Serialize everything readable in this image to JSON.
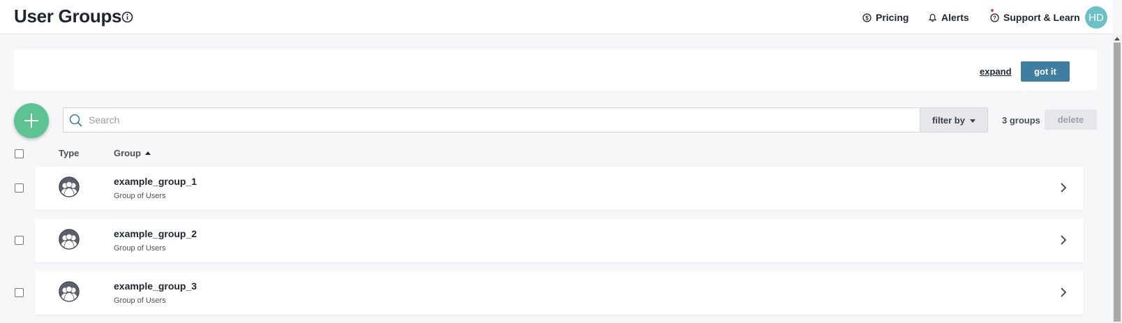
{
  "header": {
    "title": "User Groups",
    "nav": {
      "pricing": "Pricing",
      "alerts": "Alerts",
      "support": "Support & Learn"
    },
    "avatar_initials": "HD"
  },
  "banner": {
    "expand_label": "expand",
    "got_it_label": "got it"
  },
  "toolbar": {
    "search_placeholder": "Search",
    "filter_label": "filter by",
    "count_label": "3 groups",
    "delete_label": "delete"
  },
  "table": {
    "columns": {
      "type": "Type",
      "group": "Group"
    },
    "sort": {
      "column": "Group",
      "direction": "ascending"
    },
    "rows": [
      {
        "name": "example_group_1",
        "subtitle": "Group of Users",
        "icon": "user-group-icon"
      },
      {
        "name": "example_group_2",
        "subtitle": "Group of Users",
        "icon": "user-group-icon"
      },
      {
        "name": "example_group_3",
        "subtitle": "Group of Users",
        "icon": "user-group-icon"
      }
    ]
  },
  "colors": {
    "primary_button": "#3f7ea1",
    "add_button": "#5dc393",
    "avatar": "#6cc1c6",
    "notification_dot": "#e0413b"
  }
}
